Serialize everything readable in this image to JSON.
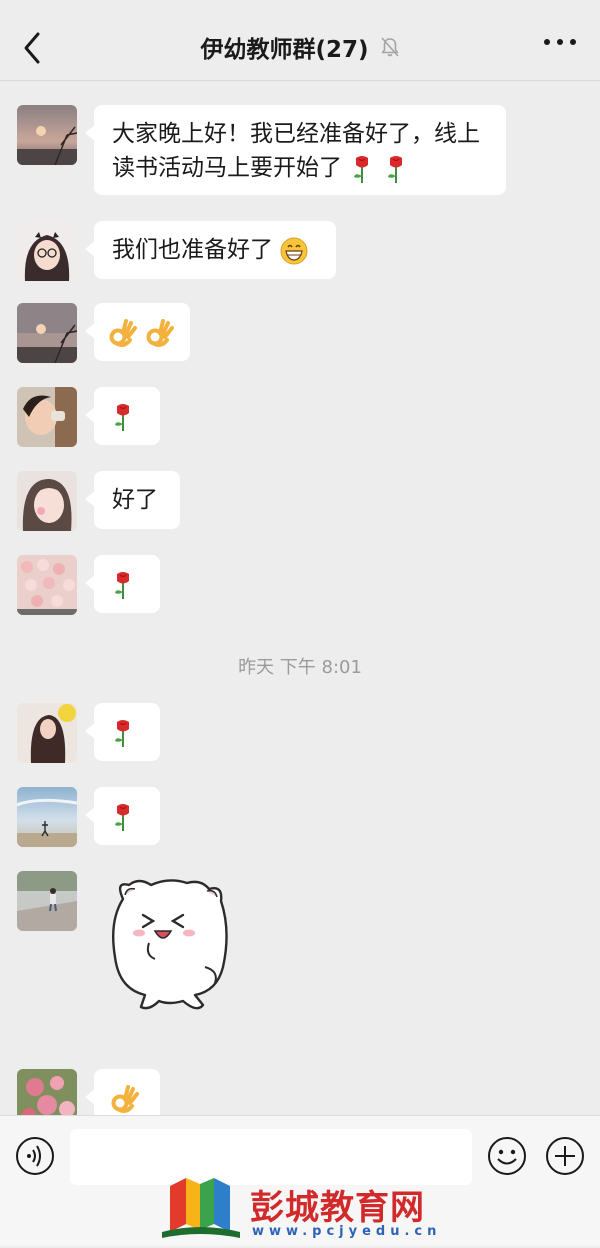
{
  "header": {
    "title": "伊幼教师群(27)"
  },
  "messages": [
    {
      "text": "大家晚上好！我已经准备好了，线上读书活动马上要开始了",
      "emojis": [
        "rose-emoji",
        "rose-emoji"
      ]
    },
    {
      "text": "我们也准备好了",
      "emojis": [
        "grin-emoji"
      ]
    },
    {
      "text": "",
      "emojis": [
        "ok-hand-emoji",
        "ok-hand-emoji"
      ]
    },
    {
      "text": "",
      "emojis": [
        "rose-emoji"
      ]
    },
    {
      "text": "好了",
      "emojis": []
    },
    {
      "text": "",
      "emojis": [
        "rose-emoji"
      ]
    },
    {
      "text": "",
      "emojis": [
        "rose-emoji"
      ]
    },
    {
      "text": "",
      "emojis": [
        "rose-emoji"
      ]
    },
    {
      "sticker": "white-cat-laughing-sticker"
    },
    {
      "text": "",
      "emojis": [
        "ok-hand-emoji"
      ]
    }
  ],
  "timestamp": "昨天 下午 8:01",
  "input": {
    "value": ""
  },
  "watermark": {
    "text": "彭城教育网",
    "url": "www.pcjyedu.cn"
  }
}
